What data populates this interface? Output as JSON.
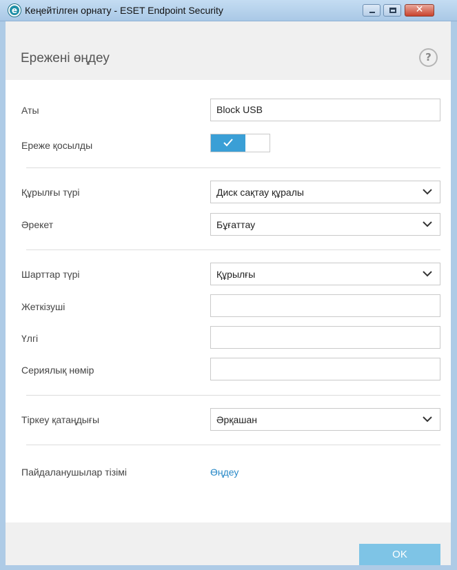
{
  "window": {
    "title": "Кеңейтілген орнату - ESET Endpoint Security",
    "icon": "eset-logo-icon",
    "close_glyph": "✕"
  },
  "header": {
    "title": "Ережені өңдеу",
    "help_glyph": "?"
  },
  "form": {
    "name_label": "Аты",
    "name_value": "Block USB",
    "enabled_label": "Ереже қосылды",
    "enabled": true,
    "device_type_label": "Құрылғы түрі",
    "device_type_value": "Диск сақтау құралы",
    "action_label": "Әрекет",
    "action_value": "Бұғаттау",
    "criteria_type_label": "Шарттар түрі",
    "criteria_type_value": "Құрылғы",
    "vendor_label": "Жеткізуші",
    "vendor_value": "",
    "model_label": "Үлгі",
    "model_value": "",
    "serial_label": "Сериялық нөмір",
    "serial_value": "",
    "log_severity_label": "Тіркеу қатаңдығы",
    "log_severity_value": "Әрқашан",
    "user_list_label": "Пайдаланушылар тізімі",
    "user_list_link": "Өңдеу"
  },
  "footer": {
    "ok_label": "OK"
  },
  "colors": {
    "accent": "#3a9fd6",
    "link": "#2a8ac8",
    "ok_button": "#7ec4e6"
  }
}
